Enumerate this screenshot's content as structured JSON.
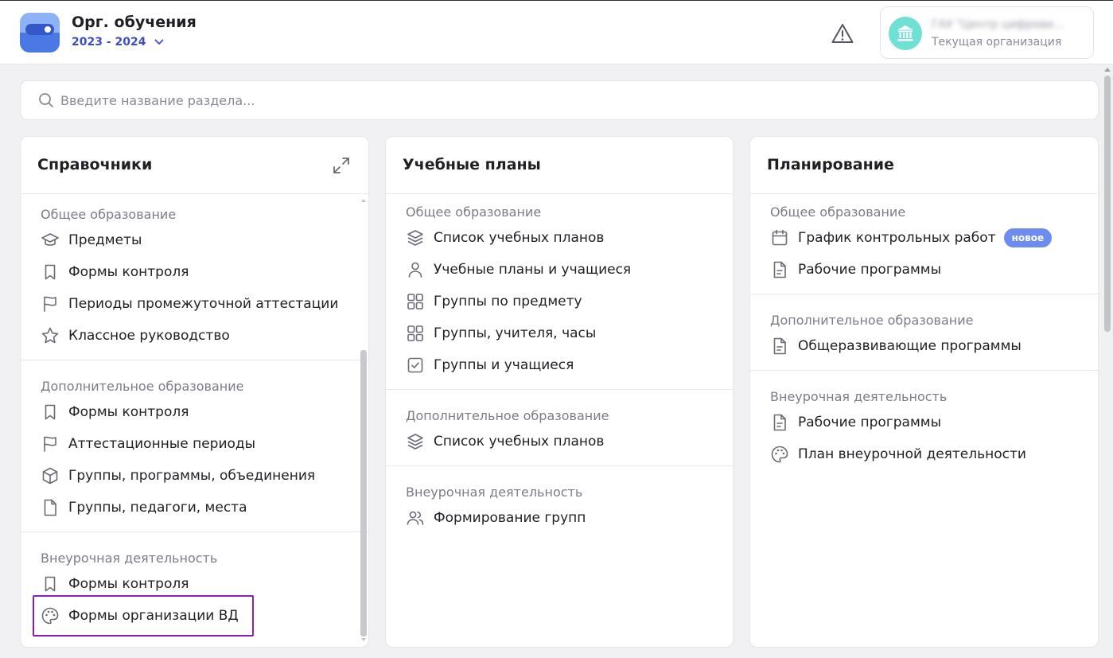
{
  "header": {
    "app_title": "Орг. обучения",
    "year": "2023 - 2024",
    "org_name": "ГАУ \"Центр цифрови...",
    "org_subtitle": "Текущая организация"
  },
  "search": {
    "placeholder": "Введите название раздела..."
  },
  "panels": [
    {
      "title": "Справочники",
      "sections": [
        {
          "title": "Общее образование",
          "items": [
            {
              "label": "Предметы",
              "icon": "graduation-cap-icon"
            },
            {
              "label": "Формы контроля",
              "icon": "bookmark-icon"
            },
            {
              "label": "Периоды промежуточной аттестации",
              "icon": "flag-icon"
            },
            {
              "label": "Классное руководство",
              "icon": "star-icon"
            }
          ]
        },
        {
          "title": "Дополнительное образование",
          "items": [
            {
              "label": "Формы контроля",
              "icon": "bookmark-icon"
            },
            {
              "label": "Аттестационные периоды",
              "icon": "flag-icon"
            },
            {
              "label": "Группы, программы, объединения",
              "icon": "box-icon"
            },
            {
              "label": "Группы, педагоги, места",
              "icon": "file-icon"
            }
          ]
        },
        {
          "title": "Внеурочная деятельность",
          "items": [
            {
              "label": "Формы контроля",
              "icon": "bookmark-icon"
            },
            {
              "label": "Формы организации ВД",
              "icon": "palette-icon"
            }
          ]
        }
      ]
    },
    {
      "title": "Учебные планы",
      "sections": [
        {
          "title": "Общее образование",
          "items": [
            {
              "label": "Список учебных планов",
              "icon": "layers-icon"
            },
            {
              "label": "Учебные планы и учащиеся",
              "icon": "user-icon"
            },
            {
              "label": "Группы по предмету",
              "icon": "grid-icon"
            },
            {
              "label": "Группы, учителя, часы",
              "icon": "grid-icon"
            },
            {
              "label": "Группы и учащиеся",
              "icon": "check-square-icon"
            }
          ]
        },
        {
          "title": "Дополнительное образование",
          "items": [
            {
              "label": "Список учебных планов",
              "icon": "layers-icon"
            }
          ]
        },
        {
          "title": "Внеурочная деятельность",
          "items": [
            {
              "label": "Формирование групп",
              "icon": "users-icon"
            }
          ]
        }
      ]
    },
    {
      "title": "Планирование",
      "sections": [
        {
          "title": "Общее образование",
          "items": [
            {
              "label": "График контрольных работ",
              "icon": "calendar-icon",
              "badge": "новое"
            },
            {
              "label": "Рабочие программы",
              "icon": "document-icon"
            }
          ]
        },
        {
          "title": "Дополнительное образование",
          "items": [
            {
              "label": "Общеразвивающие программы",
              "icon": "document-icon"
            }
          ]
        },
        {
          "title": "Внеурочная деятельность",
          "items": [
            {
              "label": "Рабочие программы",
              "icon": "document-icon"
            },
            {
              "label": "План внеурочной деятельности",
              "icon": "palette-icon"
            }
          ]
        }
      ]
    }
  ],
  "colors": {
    "accent": "#3d4ec2",
    "badge": "#6d8cf0",
    "highlight": "#8b1ec4",
    "org_avatar": "#6ee0d4"
  }
}
